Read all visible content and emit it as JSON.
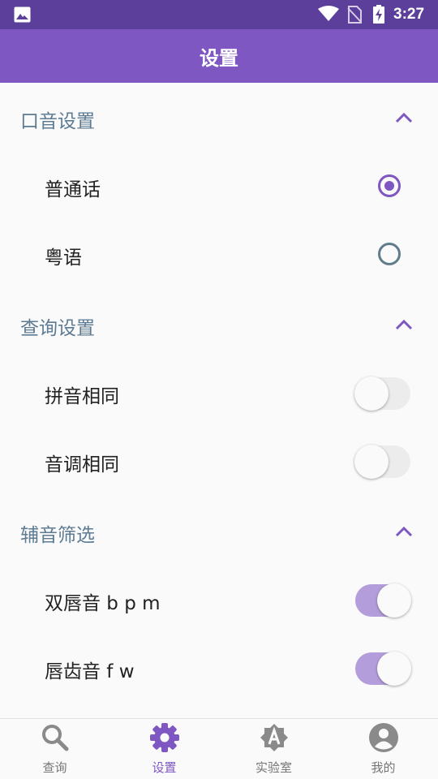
{
  "status_bar": {
    "time": "3:27"
  },
  "app_bar": {
    "title": "设置"
  },
  "sections": {
    "accent": {
      "title": "口音设置",
      "options": [
        {
          "label": "普通话",
          "selected": true
        },
        {
          "label": "粤语",
          "selected": false
        }
      ]
    },
    "query": {
      "title": "查询设置",
      "toggles": [
        {
          "label": "拼音相同",
          "on": false
        },
        {
          "label": "音调相同",
          "on": false
        }
      ]
    },
    "filter": {
      "title": "辅音筛选",
      "toggles": [
        {
          "label": "双唇音 b p m",
          "on": true
        },
        {
          "label": "唇齿音 f w",
          "on": true
        }
      ]
    }
  },
  "bottom_nav": {
    "items": [
      {
        "label": "查询",
        "icon": "search-icon",
        "active": false
      },
      {
        "label": "设置",
        "icon": "gear-icon",
        "active": true
      },
      {
        "label": "实验室",
        "icon": "lab-badge-icon",
        "active": false
      },
      {
        "label": "我的",
        "icon": "account-icon",
        "active": false
      }
    ]
  },
  "colors": {
    "status_bar": "#5b3f9a",
    "app_bar": "#7e57c2",
    "accent": "#7e57c2",
    "section_title": "#5d7b93",
    "toggle_on_track": "#b39ddb"
  }
}
